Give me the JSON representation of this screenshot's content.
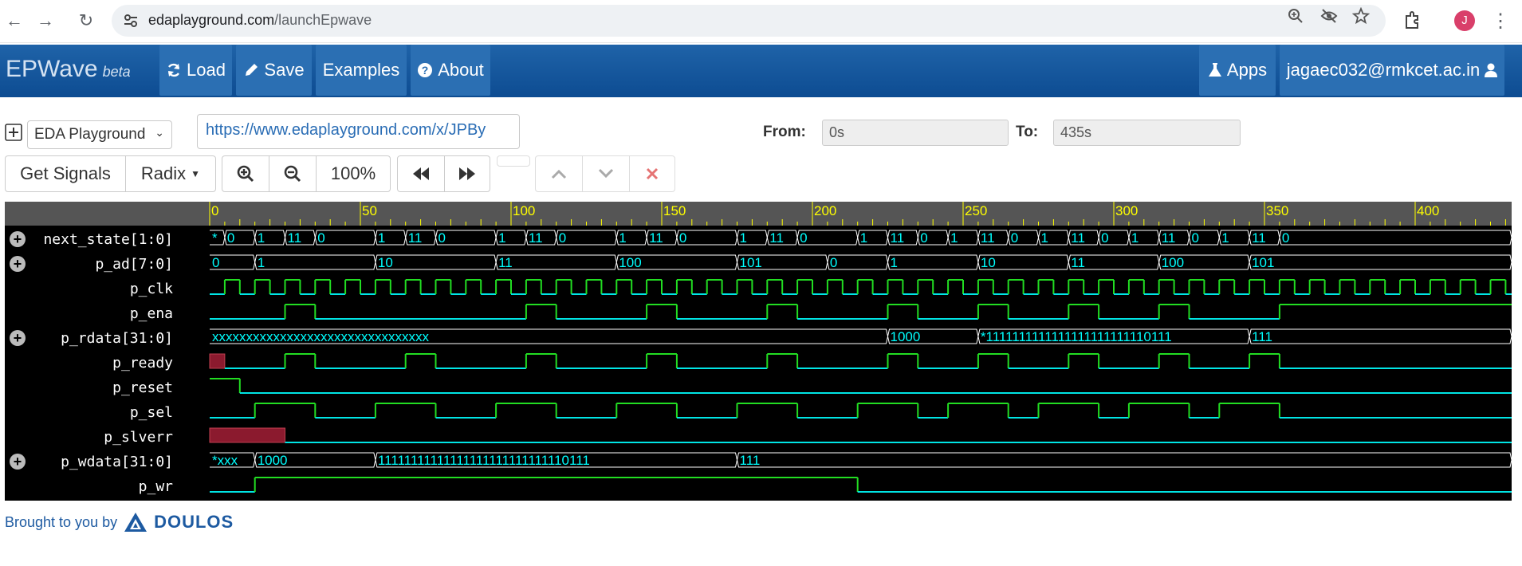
{
  "browser": {
    "url_host": "edaplayground.com",
    "url_path": "/launchEpwave",
    "avatar_letter": "J"
  },
  "navbar": {
    "brand": "EPWave",
    "brand_suffix": "beta",
    "load": "Load",
    "save": "Save",
    "examples": "Examples",
    "about": "About",
    "apps": "Apps",
    "user": "jagaec032@rmkcet.ac.in"
  },
  "toolbar": {
    "source_select": "EDA Playground",
    "share_url": "https://www.edaplayground.com/x/JPBy",
    "from_label": "From:",
    "from_value": "0s",
    "to_label": "To:",
    "to_value": "435s",
    "get_signals": "Get Signals",
    "radix": "Radix",
    "zoom_level": "100%"
  },
  "waveform": {
    "time_start": 0,
    "time_end": 435,
    "ruler_ticks": [
      "0",
      "50",
      "100",
      "150",
      "200",
      "250",
      "300",
      "350",
      "400"
    ],
    "colors": {
      "background": "#000000",
      "ruler": "#ffff00",
      "wave_low": "#00e5e5",
      "wave_high": "#22dd22",
      "bus_text": "#00ffff",
      "error_fill": "#8b1a2e"
    },
    "signals": [
      {
        "name": "next_state[1:0]",
        "bus": true
      },
      {
        "name": "p_ad[7:0]",
        "bus": true
      },
      {
        "name": "p_clk",
        "bus": false
      },
      {
        "name": "p_ena",
        "bus": false
      },
      {
        "name": "p_rdata[31:0]",
        "bus": true
      },
      {
        "name": "p_ready",
        "bus": false
      },
      {
        "name": "p_reset",
        "bus": false
      },
      {
        "name": "p_sel",
        "bus": false
      },
      {
        "name": "p_slverr",
        "bus": false
      },
      {
        "name": "p_wdata[31:0]",
        "bus": true
      },
      {
        "name": "p_wr",
        "bus": false
      }
    ],
    "bus_values": {
      "next_state": [
        [
          0,
          "*"
        ],
        [
          5,
          "0"
        ],
        [
          15,
          "1"
        ],
        [
          25,
          "11"
        ],
        [
          35,
          "0"
        ],
        [
          55,
          "1"
        ],
        [
          65,
          "11"
        ],
        [
          75,
          "0"
        ],
        [
          95,
          "1"
        ],
        [
          105,
          "11"
        ],
        [
          115,
          "0"
        ],
        [
          135,
          "1"
        ],
        [
          145,
          "11"
        ],
        [
          155,
          "0"
        ],
        [
          175,
          "1"
        ],
        [
          185,
          "11"
        ],
        [
          195,
          "0"
        ],
        [
          215,
          "1"
        ],
        [
          225,
          "11"
        ],
        [
          235,
          "0"
        ],
        [
          245,
          "1"
        ],
        [
          255,
          "11"
        ],
        [
          265,
          "0"
        ],
        [
          275,
          "1"
        ],
        [
          285,
          "11"
        ],
        [
          295,
          "0"
        ],
        [
          305,
          "1"
        ],
        [
          315,
          "11"
        ],
        [
          325,
          "0"
        ],
        [
          335,
          "1"
        ],
        [
          345,
          "11"
        ],
        [
          355,
          "0"
        ]
      ],
      "p_ad": [
        [
          0,
          "0"
        ],
        [
          15,
          "1"
        ],
        [
          55,
          "10"
        ],
        [
          95,
          "11"
        ],
        [
          135,
          "100"
        ],
        [
          175,
          "101"
        ],
        [
          205,
          "0"
        ],
        [
          225,
          "1"
        ],
        [
          255,
          "10"
        ],
        [
          285,
          "11"
        ],
        [
          315,
          "100"
        ],
        [
          345,
          "101"
        ]
      ],
      "p_rdata": [
        [
          0,
          "xxxxxxxxxxxxxxxxxxxxxxxxxxxxxxxx"
        ],
        [
          225,
          "1000"
        ],
        [
          255,
          "*1111111111111111111111110111"
        ],
        [
          345,
          "111"
        ]
      ],
      "p_wdata": [
        [
          0,
          "*xxx"
        ],
        [
          15,
          "1000"
        ],
        [
          55,
          "11111111111111111111111111110111"
        ],
        [
          175,
          "111"
        ]
      ]
    },
    "bits": {
      "p_clk_half_period": 5,
      "p_ena": [
        [
          0,
          0
        ],
        [
          25,
          1
        ],
        [
          35,
          0
        ],
        [
          105,
          1
        ],
        [
          115,
          0
        ],
        [
          145,
          1
        ],
        [
          155,
          0
        ],
        [
          185,
          1
        ],
        [
          195,
          0
        ],
        [
          225,
          1
        ],
        [
          235,
          0
        ],
        [
          255,
          1
        ],
        [
          265,
          0
        ],
        [
          285,
          1
        ],
        [
          295,
          0
        ],
        [
          315,
          1
        ],
        [
          325,
          0
        ],
        [
          355,
          1
        ]
      ],
      "p_ready": [
        [
          0,
          "x"
        ],
        [
          5,
          0
        ],
        [
          25,
          1
        ],
        [
          35,
          0
        ],
        [
          65,
          1
        ],
        [
          75,
          0
        ],
        [
          105,
          1
        ],
        [
          115,
          0
        ],
        [
          145,
          1
        ],
        [
          155,
          0
        ],
        [
          185,
          1
        ],
        [
          195,
          0
        ],
        [
          225,
          1
        ],
        [
          235,
          0
        ],
        [
          255,
          1
        ],
        [
          265,
          0
        ],
        [
          285,
          1
        ],
        [
          295,
          0
        ],
        [
          315,
          1
        ],
        [
          325,
          0
        ],
        [
          345,
          1
        ],
        [
          355,
          0
        ]
      ],
      "p_reset": [
        [
          0,
          1
        ],
        [
          10,
          0
        ]
      ],
      "p_sel": [
        [
          0,
          0
        ],
        [
          15,
          1
        ],
        [
          35,
          0
        ],
        [
          55,
          1
        ],
        [
          75,
          0
        ],
        [
          95,
          1
        ],
        [
          115,
          0
        ],
        [
          135,
          1
        ],
        [
          155,
          0
        ],
        [
          175,
          1
        ],
        [
          195,
          0
        ],
        [
          215,
          1
        ],
        [
          235,
          0
        ],
        [
          245,
          1
        ],
        [
          265,
          0
        ],
        [
          275,
          1
        ],
        [
          295,
          0
        ],
        [
          305,
          1
        ],
        [
          325,
          0
        ],
        [
          335,
          1
        ],
        [
          355,
          0
        ]
      ],
      "p_slverr": [
        [
          0,
          "x"
        ],
        [
          25,
          0
        ]
      ],
      "p_wr": [
        [
          0,
          0
        ],
        [
          15,
          1
        ],
        [
          215,
          0
        ]
      ]
    }
  },
  "footer": {
    "text": "Brought to you by",
    "brand": "DOULOS"
  }
}
